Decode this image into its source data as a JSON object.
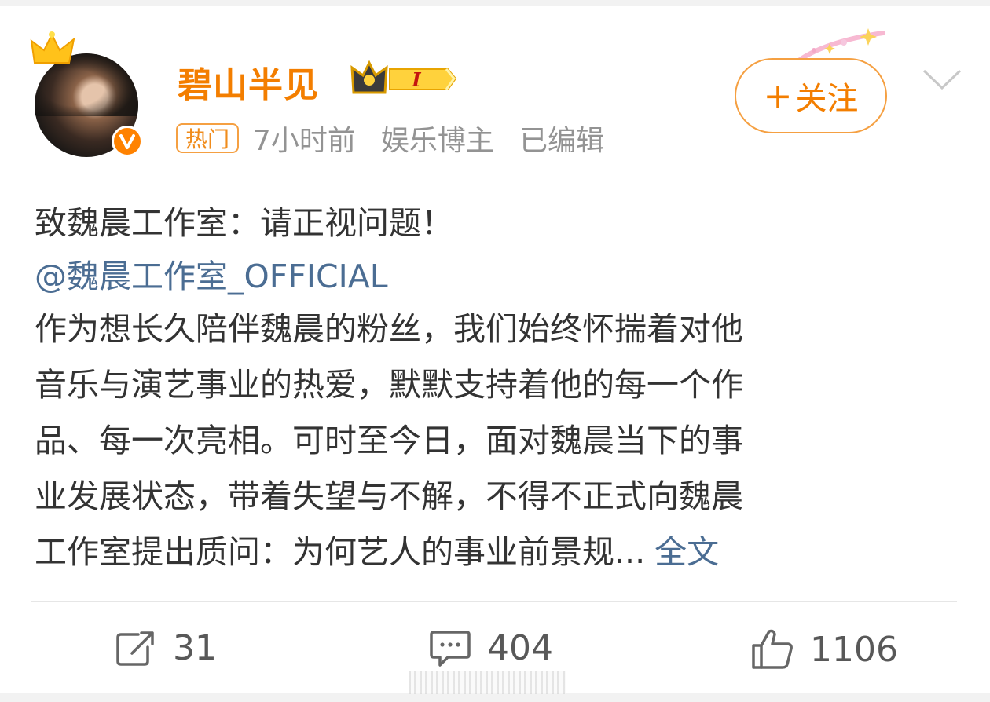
{
  "user": {
    "name": "碧山半见",
    "vip_level": "I",
    "avatar": "avatar-photo",
    "verified_icon": "verified-v-icon"
  },
  "meta": {
    "tag": "热门",
    "time": "7小时前",
    "category": "娱乐博主",
    "edited": "已编辑"
  },
  "follow": {
    "plus": "+",
    "label": "关注"
  },
  "post": {
    "title": "致魏晨工作室：请正视问题！",
    "mention": "@魏晨工作室_OFFICIAL",
    "lines": [
      "作为想长久陪伴魏晨的粉丝，我们始终怀揣着对他",
      "音乐与演艺事业的热爱，默默支持着他的每一个作",
      "品、每一次亮相。可时至今日，面对魏晨当下的事",
      "业发展状态，带着失望与不解，不得不正式向魏晨",
      "工作室提出质问：为何艺人的事业前景规..."
    ],
    "full_text_link": "全文"
  },
  "actions": {
    "share": {
      "icon": "share-icon",
      "count": "31"
    },
    "comment": {
      "icon": "comment-icon",
      "count": "404"
    },
    "like": {
      "icon": "thumbs-up-icon",
      "count": "1106"
    }
  },
  "colors": {
    "accent_orange": "#f37e00",
    "link_blue": "#4b6d93",
    "meta_gray": "#939393"
  }
}
